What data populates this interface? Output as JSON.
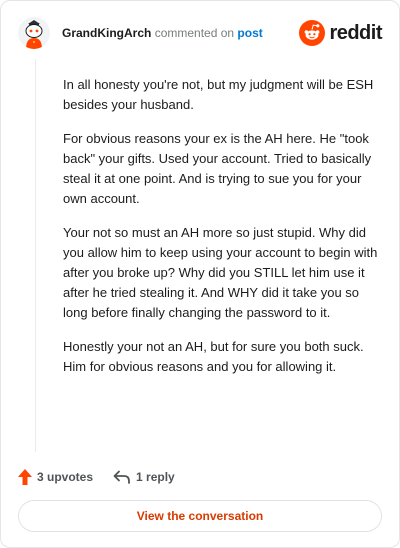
{
  "header": {
    "username": "GrandKingArch",
    "action_text": "commented on",
    "post_link": "post",
    "brand": "reddit",
    "avatar_icon": "snoo-avatar-icon",
    "brand_icon": "reddit-logo-icon"
  },
  "comment": {
    "paragraphs": [
      "In all honesty you're not, but my judgment will be ESH besides your husband.",
      "For obvious reasons your ex is the AH here. He \"took back\" your gifts. Used your account. Tried to basically steal it at one point. And is trying to sue you for your own account.",
      "Your not so must an AH more so just stupid. Why did you allow him to keep using your account to begin with after you broke up? Why did you STILL let him use it after he tried stealing it. And WHY did it take you so long before finally changing the password to it.",
      "Honestly your not an AH, but for sure you both suck. Him for obvious reasons and you for allowing it."
    ]
  },
  "actions": {
    "upvotes": "3 upvotes",
    "replies": "1 reply",
    "upvote_icon": "upvote-arrow-icon",
    "reply_icon": "reply-arrow-icon"
  },
  "cta": {
    "label": "View the conversation"
  },
  "colors": {
    "accent": "#d93a00",
    "link": "#0079d3",
    "reddit_orange": "#ff4500",
    "text": "#1c1c1c",
    "muted": "#787c7e"
  }
}
